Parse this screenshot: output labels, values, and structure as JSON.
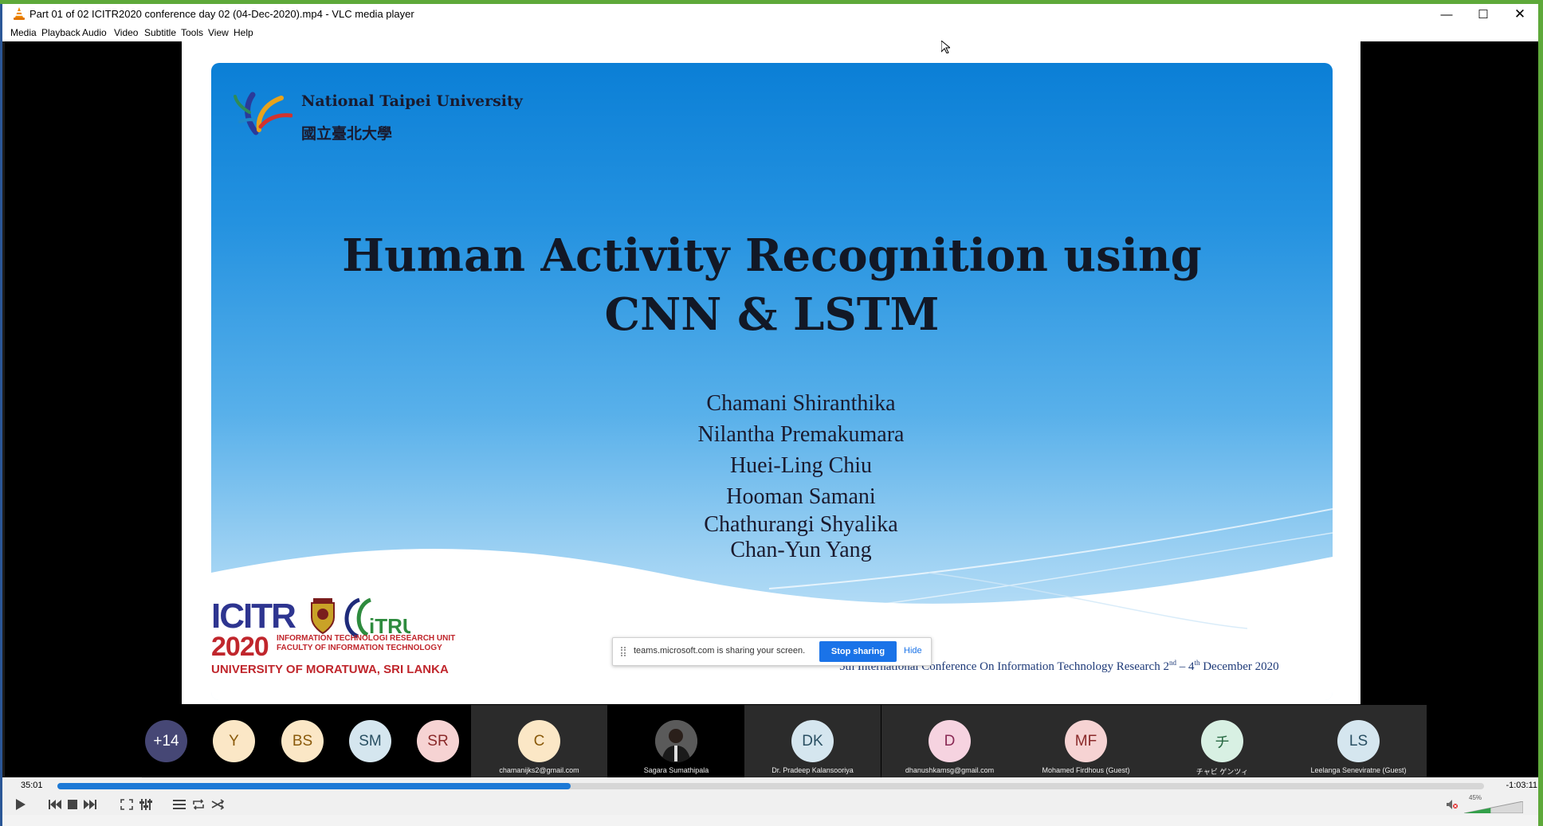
{
  "window": {
    "title": "Part 01 of 02 ICITR2020 conference day 02 (04-Dec-2020).mp4 - VLC media player",
    "minimize": "—",
    "maximize": "☐",
    "close": "✕"
  },
  "menu": [
    "Media",
    "Playback",
    "Audio",
    "Video",
    "Subtitle",
    "Tools",
    "View",
    "Help"
  ],
  "slide": {
    "university_en": "National Taipei University",
    "university_zh": "國立臺北大學",
    "title_line1": "Human Activity Recognition using",
    "title_line2": "CNN & LSTM",
    "authors": [
      "Chamani Shiranthika",
      "Nilantha Premakumara",
      "Huei-Ling Chiu",
      "Hooman Samani",
      "Chathurangi Shyalika",
      "Chan-Yun Yang"
    ],
    "icitr_big": "ICITR",
    "icitr_year": "2020",
    "itru_logo_text": "iTRU",
    "icitr_unit1": "INFORMATION TECHNOLOGI RESEARCH UNIT",
    "icitr_unit2": "FACULTY OF INFORMATION TECHNOLOGY",
    "icitr_uni": "UNIVERSITY OF MORATUWA, SRI LANKA",
    "conf_a": "5th International Conference On Information Technology Research 2",
    "conf_sup1": "nd",
    "conf_b": " – 4",
    "conf_sup2": "th",
    "conf_c": " December 2020"
  },
  "sharing": {
    "text": "teams.microsoft.com is sharing your screen.",
    "stop": "Stop sharing",
    "hide": "Hide"
  },
  "participants": [
    {
      "initials": "+14",
      "name": "",
      "bg": "#464775",
      "fg": "#ffffff"
    },
    {
      "initials": "Y",
      "name": "",
      "bg": "#fbe7c6",
      "fg": "#8a5a0b"
    },
    {
      "initials": "BS",
      "name": "",
      "bg": "#fbe7c6",
      "fg": "#8a5a0b"
    },
    {
      "initials": "SM",
      "name": "",
      "bg": "#d5e6ef",
      "fg": "#2a5063"
    },
    {
      "initials": "SR",
      "name": "",
      "bg": "#f6d3d3",
      "fg": "#8a2a2a"
    },
    {
      "initials": "C",
      "name": "chamanijks2@gmail.com",
      "bg": "#fbe7c6",
      "fg": "#8a5a0b"
    },
    {
      "initials": "",
      "name": "Sagara Sumathipala",
      "bg": "#3a3a3a",
      "fg": "#ffffff"
    },
    {
      "initials": "DK",
      "name": "Dr. Pradeep Kalansooriya",
      "bg": "#d5e6ef",
      "fg": "#2a5063"
    },
    {
      "initials": "D",
      "name": "dhanushkamsg@gmail.com",
      "bg": "#f6d3e0",
      "fg": "#8a2a55"
    },
    {
      "initials": "MF",
      "name": "Mohamed Firdhous (Guest)",
      "bg": "#f6d3d3",
      "fg": "#8a2a2a"
    },
    {
      "initials": "チ",
      "name": "チャビ ゲンツィ",
      "bg": "#d8f0e3",
      "fg": "#2a6a45"
    },
    {
      "initials": "LS",
      "name": "Leelanga Seneviratne (Guest)",
      "bg": "#d5e6ef",
      "fg": "#2a5063"
    }
  ],
  "player": {
    "elapsed": "35:01",
    "remaining": "-1:03:11",
    "progress": 0.36,
    "volume_label": "45%",
    "volume": 0.45
  },
  "colors": {
    "accent": "#1c79d6",
    "border_green": "#5ea93a"
  }
}
